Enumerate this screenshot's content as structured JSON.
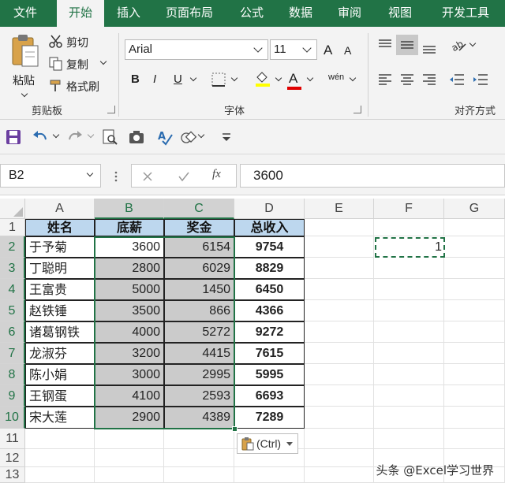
{
  "ribbon_tabs": [
    {
      "label": "文件"
    },
    {
      "label": "开始"
    },
    {
      "label": "插入"
    },
    {
      "label": "页面布局"
    },
    {
      "label": "公式"
    },
    {
      "label": "数据"
    },
    {
      "label": "审阅"
    },
    {
      "label": "视图"
    },
    {
      "label": "开发工具"
    }
  ],
  "clipboard": {
    "paste_label": "粘贴",
    "cut_label": "剪切",
    "copy_label": "复制",
    "format_painter_label": "格式刷",
    "group_label": "剪贴板"
  },
  "font": {
    "name": "Arial",
    "size": "11",
    "bold": "B",
    "italic": "I",
    "underline": "U",
    "font_color": "A",
    "grow": "A",
    "shrink": "A",
    "phonetic": "wén",
    "group_label": "字体"
  },
  "alignment": {
    "group_label": "对齐方式"
  },
  "formula_bar": {
    "name_box": "B2",
    "formula": "3600",
    "fx": "fx"
  },
  "columns": [
    "A",
    "B",
    "C",
    "D",
    "E",
    "F",
    "G"
  ],
  "rows": [
    "1",
    "2",
    "3",
    "4",
    "5",
    "6",
    "7",
    "8",
    "9",
    "10",
    "11",
    "12",
    "13"
  ],
  "table": {
    "headers": [
      "姓名",
      "底薪",
      "奖金",
      "总收入"
    ],
    "rows": [
      [
        "于予菊",
        "3600",
        "6154",
        "9754"
      ],
      [
        "丁聪明",
        "2800",
        "6029",
        "8829"
      ],
      [
        "王富贵",
        "5000",
        "1450",
        "6450"
      ],
      [
        "赵铁锤",
        "3500",
        "866",
        "4366"
      ],
      [
        "诸葛钢铁",
        "4000",
        "5272",
        "9272"
      ],
      [
        "龙淑芬",
        "3200",
        "4415",
        "7615"
      ],
      [
        "陈小娟",
        "3000",
        "2995",
        "5995"
      ],
      [
        "王钢蛋",
        "4100",
        "2593",
        "6693"
      ],
      [
        "宋大莲",
        "2900",
        "4389",
        "7289"
      ]
    ]
  },
  "copied_cell_value": "1",
  "paste_options_label": "(Ctrl)",
  "watermark": "头条 @Excel学习世界",
  "colors": {
    "accent": "#217346",
    "header_fill": "#bdd7ee",
    "selection_fill": "#cbcbcb"
  }
}
